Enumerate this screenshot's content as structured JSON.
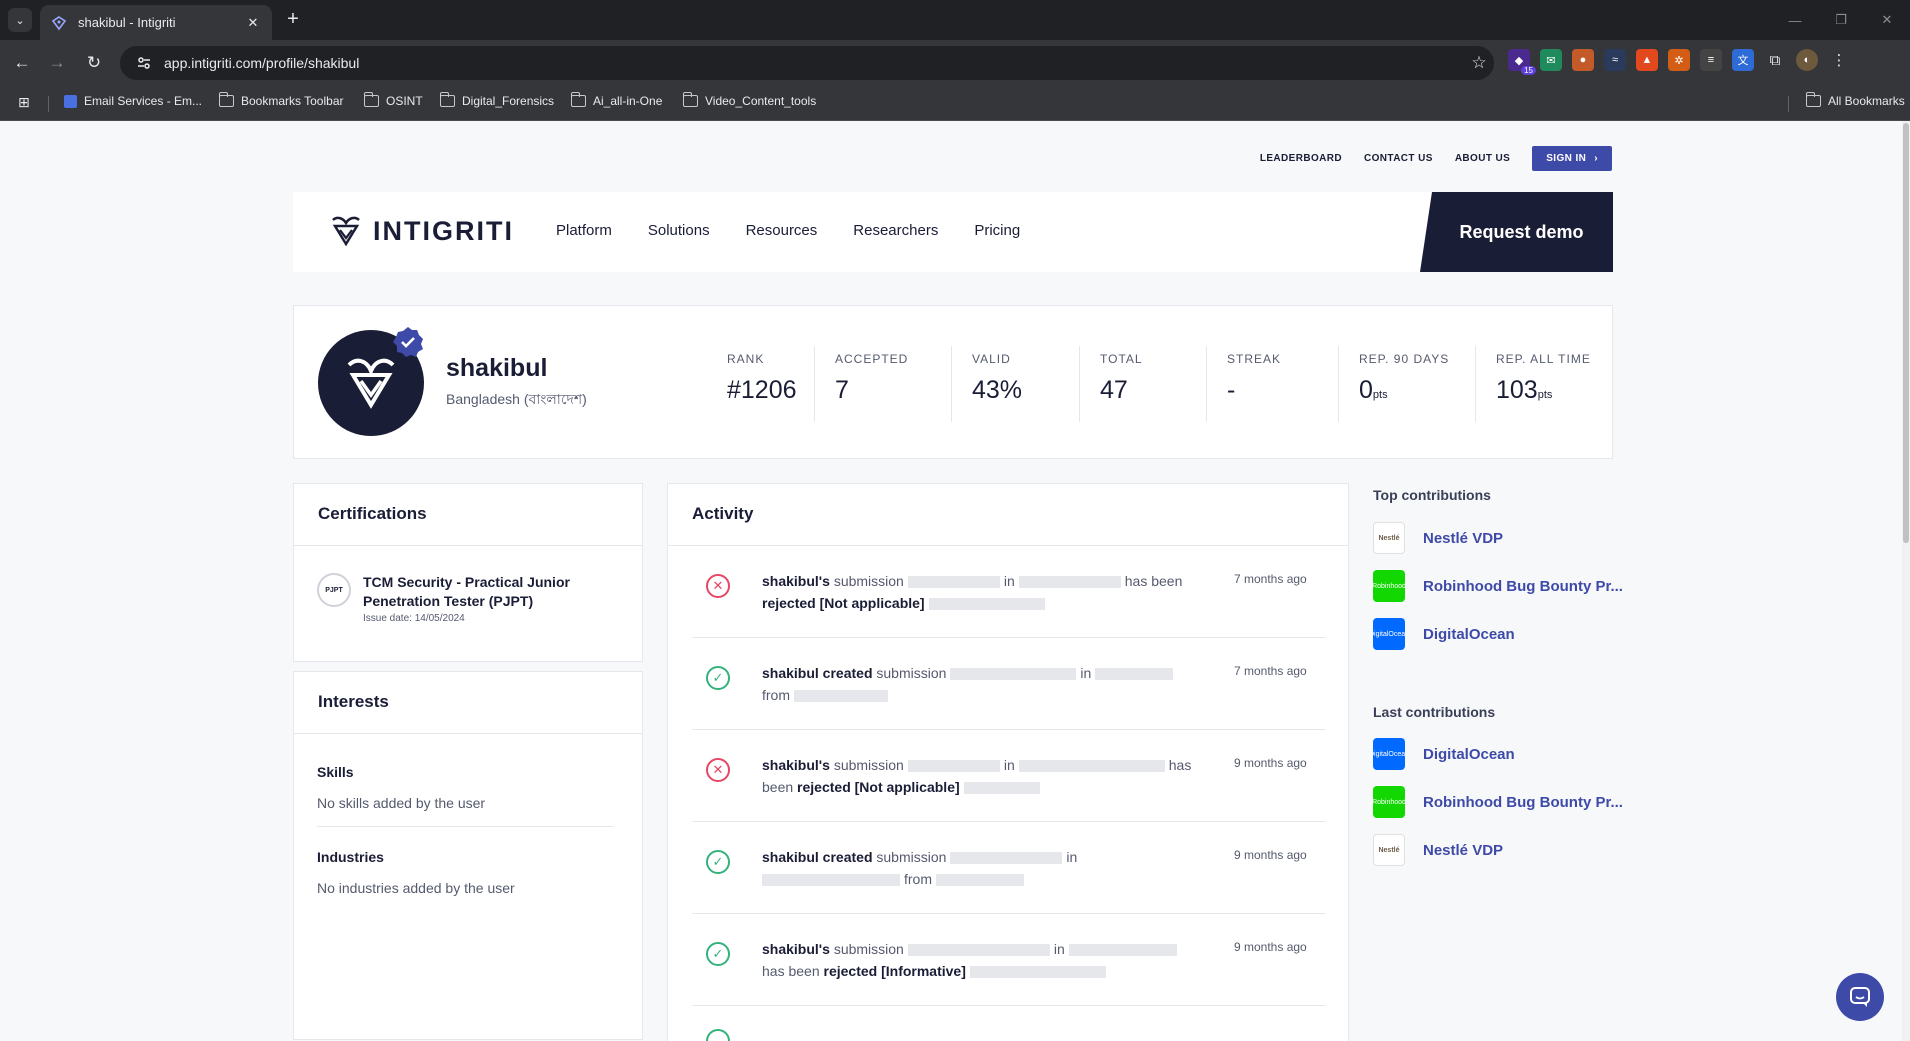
{
  "browser": {
    "tab_title": "shakibul - Intigriti",
    "url": "app.intigriti.com/profile/shakibul",
    "extension_badge": "15",
    "bookmarks": [
      "Email Services - Em...",
      "Bookmarks Toolbar",
      "OSINT",
      "Digital_Forensics",
      "Ai_all-in-One",
      "Video_Content_tools"
    ],
    "all_bookmarks": "All Bookmarks"
  },
  "topnav": {
    "leaderboard": "LEADERBOARD",
    "contact": "CONTACT US",
    "about": "ABOUT US",
    "signin": "SIGN IN"
  },
  "mainnav": {
    "logo": "INTIGRITI",
    "items": [
      "Platform",
      "Solutions",
      "Resources",
      "Researchers",
      "Pricing"
    ],
    "demo": "Request demo"
  },
  "profile": {
    "username": "shakibul",
    "country": "Bangladesh (বাংলাদেশ)",
    "stats": [
      {
        "label": "RANK",
        "value": "#1206",
        "unit": ""
      },
      {
        "label": "ACCEPTED",
        "value": "7",
        "unit": ""
      },
      {
        "label": "VALID",
        "value": "43%",
        "unit": ""
      },
      {
        "label": "TOTAL",
        "value": "47",
        "unit": ""
      },
      {
        "label": "STREAK",
        "value": "-",
        "unit": ""
      },
      {
        "label": "REP. 90 DAYS",
        "value": "0",
        "unit": "pts"
      },
      {
        "label": "REP. ALL TIME",
        "value": "103",
        "unit": "pts"
      }
    ]
  },
  "certifications": {
    "title": "Certifications",
    "badge": "PJPT",
    "cert_title": "TCM Security - Practical Junior Penetration Tester (PJPT)",
    "issue_date": "Issue date: 14/05/2024"
  },
  "interests": {
    "title": "Interests",
    "skills_title": "Skills",
    "skills_text": "No skills added by the user",
    "industries_title": "Industries",
    "industries_text": "No industries added by the user"
  },
  "activity": {
    "title": "Activity",
    "items": [
      {
        "user": "shakibul's",
        "w1": "submission",
        "w2": "in",
        "w3": "has been",
        "status": "rejected [Not applicable]",
        "time": "7 months ago"
      },
      {
        "user": "shakibul created",
        "w1": "submission",
        "w2": "in",
        "w3": "from",
        "time": "7 months ago"
      },
      {
        "user": "shakibul's",
        "w1": "submission",
        "w2": "in",
        "w3": "has been",
        "status": "rejected [Not applicable]",
        "time": "9 months ago"
      },
      {
        "user": "shakibul created",
        "w1": "submission",
        "w2": "in",
        "w3": "from",
        "time": "9 months ago"
      },
      {
        "user": "shakibul's",
        "w1": "submission",
        "w2": "in",
        "w3": "has been",
        "status": "rejected [Informative]",
        "time": "9 months ago"
      }
    ]
  },
  "contributions": {
    "top_title": "Top contributions",
    "top": [
      "Nestlé VDP",
      "Robinhood Bug Bounty Pr...",
      "DigitalOcean"
    ],
    "last_title": "Last contributions",
    "last": [
      "DigitalOcean",
      "Robinhood Bug Bounty Pr...",
      "Nestlé VDP"
    ],
    "logo_text": {
      "nestle": "Nestlé",
      "robinhood": "Robinhood",
      "digitalocean": "DigitalOcean"
    }
  },
  "colors": {
    "accent": "#3e4aa8",
    "navy": "#1a1d36",
    "reject": "#e74764",
    "accept": "#34b27b"
  }
}
